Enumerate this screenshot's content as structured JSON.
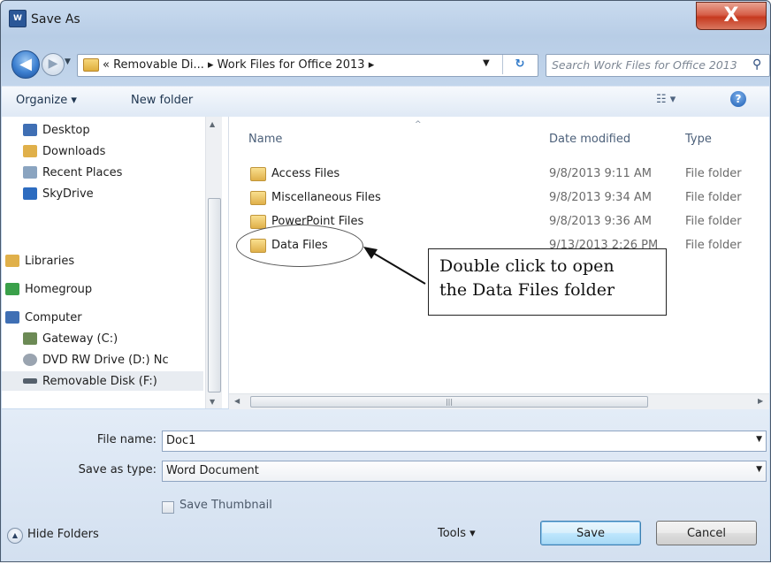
{
  "window": {
    "title": "Save As",
    "app_icon": "word-app-icon",
    "close_label": "X"
  },
  "nav": {
    "address_prefix": "«",
    "address_crumbs": [
      "Removable Di...",
      "Work Files for Office 2013"
    ],
    "search_placeholder": "Search Work Files for Office 2013"
  },
  "toolbar": {
    "organize_label": "Organize ▾",
    "new_folder_label": "New folder",
    "views_label": "☷ ▾",
    "help_label": "?"
  },
  "navpane": {
    "items": [
      {
        "label": "Desktop",
        "icon": "desktop-icon",
        "color": "#3f6fb4"
      },
      {
        "label": "Downloads",
        "icon": "downloads-folder-icon",
        "color": "#e0b04a"
      },
      {
        "label": "Recent Places",
        "icon": "recent-places-icon",
        "color": "#8aa4c0"
      },
      {
        "label": "SkyDrive",
        "icon": "skydrive-icon",
        "color": "#2d6cc0"
      },
      {
        "label": "Libraries",
        "icon": "libraries-icon",
        "color": "#e0b04a"
      },
      {
        "label": "Homegroup",
        "icon": "homegroup-icon",
        "color": "#3aa04a"
      },
      {
        "label": "Computer",
        "icon": "computer-icon",
        "color": "#3f6fb4"
      },
      {
        "label": "Gateway (C:)",
        "icon": "hard-drive-icon",
        "color": "#6c8a55"
      },
      {
        "label": "DVD RW Drive (D:) Nc",
        "icon": "dvd-drive-icon",
        "color": "#9aa4b0"
      },
      {
        "label": "Removable Disk (F:)",
        "icon": "removable-disk-icon",
        "color": "#55606c"
      }
    ]
  },
  "filelist": {
    "columns": [
      "Name",
      "Date modified",
      "Type"
    ],
    "rows": [
      {
        "name": "Access Files",
        "date": "9/8/2013 9:11 AM",
        "type": "File folder"
      },
      {
        "name": "Miscellaneous Files",
        "date": "9/8/2013 9:34 AM",
        "type": "File folder"
      },
      {
        "name": "PowerPoint Files",
        "date": "9/8/2013 9:36 AM",
        "type": "File folder"
      },
      {
        "name": "Data Files",
        "date": "9/13/2013 2:26 PM",
        "type": "File folder"
      }
    ]
  },
  "callout": {
    "line1": "Double click to open",
    "line2": "the Data Files folder"
  },
  "form": {
    "file_name_label": "File name:",
    "file_name_value": "Doc1",
    "save_type_label": "Save as type:",
    "save_type_value": "Word Document",
    "thumbnail_label": "Save Thumbnail",
    "hide_folders_label": "Hide Folders",
    "tools_label": "Tools ▾",
    "save_label": "Save",
    "cancel_label": "Cancel"
  },
  "colors": {
    "accent": "#3c7fb1",
    "close": "#c6391f"
  }
}
